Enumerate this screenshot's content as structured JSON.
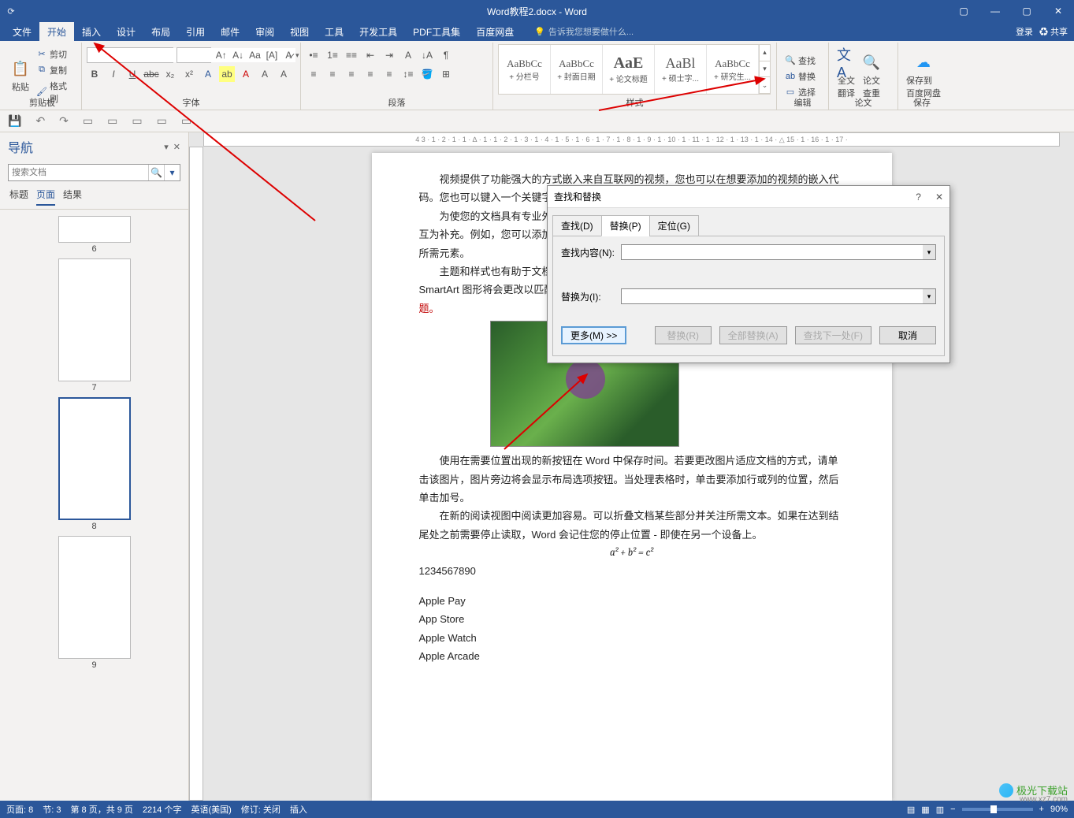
{
  "app": {
    "title": "Word教程2.docx - Word",
    "login": "登录",
    "share": "共享"
  },
  "tabs": {
    "file": "文件",
    "home": "开始",
    "insert": "插入",
    "design": "设计",
    "layout": "布局",
    "references": "引用",
    "mailings": "邮件",
    "review": "审阅",
    "view": "视图",
    "tools": "工具",
    "dev": "开发工具",
    "pdf": "PDF工具集",
    "baidu": "百度网盘",
    "tellme": "告诉我您想要做什么..."
  },
  "ribbon": {
    "clipboard": {
      "label": "剪贴板",
      "paste": "粘贴",
      "cut": "剪切",
      "copy": "复制",
      "format_painter": "格式刷"
    },
    "font": {
      "label": "字体",
      "name": "",
      "size": ""
    },
    "paragraph": {
      "label": "段落"
    },
    "styles": {
      "label": "样式",
      "items": [
        {
          "preview": "AaBbCc",
          "name": "+ 分栏号"
        },
        {
          "preview": "AaBbCc",
          "name": "+ 封面日期"
        },
        {
          "preview": "AaE",
          "name": "+ 论文标题"
        },
        {
          "preview": "AaBl",
          "name": "+ 硕士字..."
        },
        {
          "preview": "AaBbCc",
          "name": "+ 研究生..."
        }
      ]
    },
    "editing": {
      "label": "编辑",
      "find": "查找",
      "replace": "替换",
      "select": "选择"
    },
    "translate": {
      "label": "论文",
      "full": "全文\n翻译",
      "check": "论文\n查重"
    },
    "save": {
      "label": "保存",
      "btn": "保存到\n百度网盘"
    }
  },
  "nav": {
    "title": "导航",
    "search_ph": "搜索文档",
    "tabs": {
      "headings": "标题",
      "pages": "页面",
      "results": "结果"
    },
    "pages": [
      6,
      7,
      8,
      9
    ],
    "active": 8
  },
  "doc": {
    "p1": "视频提供了功能强大的方式嵌入来自互联网的视频，您也可以在想要添加的视频的嵌入代码。您也可以键入一个关键字以联机搜索最适合您的文档的视频。",
    "p2": "为使您的文档具有专业外观，Word 提供了页眉、页脚、封面和文本框设计，这些设计可互为补充。例如，您可以添加匹配的封面、页眉和提要栏。单击\"插入\"，然后从不同库中选择所需元素。",
    "p3a": "主题和样式也有助于文档保持协调。当您单击设计并选择新的主题时，图片、图表或 SmartArt 图形将会更改以匹配新的主题。当应用标题所应用的标题时，",
    "p3b": "行更改以匹配新的主题。",
    "p4": "使用在需要位置出现的新按钮在 Word 中保存时间。若要更改图片适应文档的方式，请单击该图片，图片旁边将会显示布局选项按钮。当处理表格时，单击要添加行或列的位置，然后单击加号。",
    "p5": "在新的阅读视图中阅读更加容易。可以折叠文档某些部分并关注所需文本。如果在达到结尾处之前需要停止读取，Word 会记住您的停止位置 - 即使在另一个设备上。",
    "formula": "a² + b² = c²",
    "digits": "1234567890",
    "l1": "Apple Pay",
    "l2": "App Store",
    "l3": "Apple Watch",
    "l4": "Apple Arcade"
  },
  "dialog": {
    "title": "查找和替换",
    "tabs": {
      "find": "查找(D)",
      "replace": "替换(P)",
      "goto": "定位(G)"
    },
    "find_label": "查找内容(N):",
    "replace_label": "替换为(I):",
    "find_value": "",
    "replace_value": "",
    "more": "更多(M) >>",
    "btn_replace": "替换(R)",
    "btn_replace_all": "全部替换(A)",
    "btn_find_next": "查找下一处(F)",
    "btn_cancel": "取消"
  },
  "status": {
    "page": "页面: 8",
    "section": "节: 3",
    "page_of": "第 8 页，共 9 页",
    "words": "2214 个字",
    "lang": "英语(美国)",
    "track": "修订: 关闭",
    "insert": "插入",
    "zoom": "90%"
  },
  "ruler_text": "4 3 · 1 · 2 · 1 · 1 · ∆ · 1 · 1 · 2 · 1 · 3 · 1 · 4 · 1 · 5 · 1 · 6 · 1 · 7 · 1 · 8 · 1 · 9 · 1 · 10 · 1 · 11 · 1 · 12 · 1 · 13 · 1 · 14 · △ 15 · 1 · 16 · 1 · 17 ·",
  "watermark": {
    "text": "极光下载站",
    "url": "www.xz7.com"
  }
}
